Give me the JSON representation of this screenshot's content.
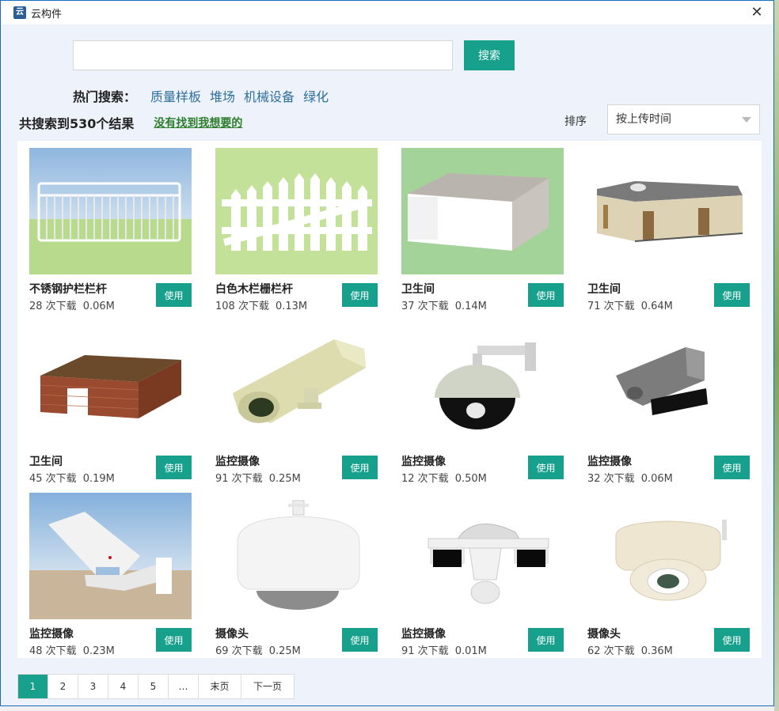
{
  "window": {
    "title": "云构件",
    "app_icon": "app-logo-icon"
  },
  "search": {
    "value": "",
    "placeholder": "",
    "button_label": "搜索"
  },
  "hot": {
    "label": "热门搜索：",
    "items": [
      "质量样板",
      "堆场",
      "机械设备",
      "绿化"
    ]
  },
  "results": {
    "count_text": "共搜索到530个结果",
    "not_found_link": "没有找到我想要的"
  },
  "sort": {
    "label": "排序",
    "selected": "按上传时间"
  },
  "card_action_label": "使用",
  "items": [
    {
      "name": "不锈钢护栏栏杆",
      "downloads": "28 次下载",
      "size": "0.06M"
    },
    {
      "name": "白色木栏栅栏杆",
      "downloads": "108 次下载",
      "size": "0.13M"
    },
    {
      "name": "卫生间",
      "downloads": "37 次下载",
      "size": "0.14M"
    },
    {
      "name": "卫生间",
      "downloads": "71 次下载",
      "size": "0.64M"
    },
    {
      "name": "卫生间",
      "downloads": "45 次下载",
      "size": "0.19M"
    },
    {
      "name": "监控摄像",
      "downloads": "91 次下载",
      "size": "0.25M"
    },
    {
      "name": "监控摄像",
      "downloads": "12 次下载",
      "size": "0.50M"
    },
    {
      "name": "监控摄像",
      "downloads": "32 次下载",
      "size": "0.06M"
    },
    {
      "name": "监控摄像",
      "downloads": "48 次下载",
      "size": "0.23M"
    },
    {
      "name": "摄像头",
      "downloads": "69 次下载",
      "size": "0.25M"
    },
    {
      "name": "监控摄像",
      "downloads": "91 次下载",
      "size": "0.01M"
    },
    {
      "name": "摄像头",
      "downloads": "62 次下载",
      "size": "0.36M"
    }
  ],
  "pagination": {
    "pages": [
      "1",
      "2",
      "3",
      "4",
      "5",
      "…",
      "末页",
      "下一页"
    ],
    "current": "1"
  },
  "colors": {
    "accent": "#17a08c",
    "link": "#2e6e9e",
    "not_found": "#2b7d2b",
    "window_border": "#1a6bc1"
  }
}
